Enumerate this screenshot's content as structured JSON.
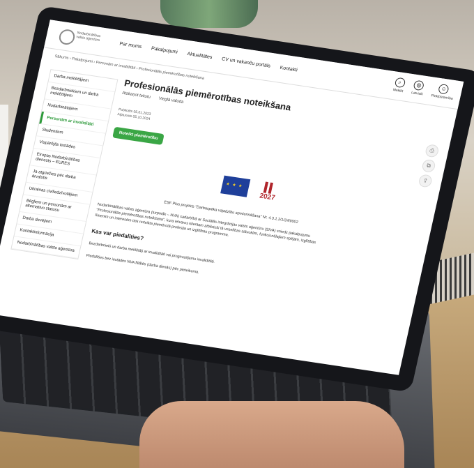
{
  "header": {
    "logo_text": "Nodarbinātības valsts aģentūra",
    "nav": [
      "Par mums",
      "Pakalpojumi",
      "Aktualitātes",
      "CV un vakanču portāls",
      "Kontakti"
    ],
    "tools": [
      "Meklēt",
      "Latviski",
      "Piekļūstamība"
    ]
  },
  "breadcrumb": "Sākums › Pakalpojumi › Personām ar invaliditāti › Profesionālās piemērotības noteikšana",
  "sidebar": {
    "items": [
      "Darba meklētājiem",
      "Bezdarbniekiem un darba meklētājiem",
      "Nodarbinātajiem",
      "Personām ar invaliditāti",
      "Studentiem",
      "Vispārējās iestādes",
      "Eiropas Nodarbinātības dienests – EURES",
      "Ja atgriežies pēc darba ārvalstīs",
      "Ukrainas civiliedzīvotājiem",
      "Bēgļiem un personām ar alternatīvo statusu",
      "Darba devējiem",
      "Kontaktinformācija",
      "Nodarbinātības valsts aģentūra"
    ],
    "active_index": 3
  },
  "main": {
    "title": "Profesionālās piemērotības noteikšana",
    "actions": [
      "Atskaņot tekstu",
      "Vieglā valoda"
    ],
    "published": "Publicēts 05.01.2023",
    "updated": "Atjaunots 05.10.2024",
    "button": "Noteikt piemērotību",
    "caption": "ESF Plus projekts \"Darbaspēka vajadzību apmierināšana\" Nr. 4.3.1.2/1/24/I/002",
    "paragraph": "Nodarbinātības valsts aģentūra (turpmāk – NVA) sadarbībā ar Sociālās integrācijas valsts aģentūru (SIVA) sniedz pakalpojumu \"Profesionālās piemērotības noteikšana\", kura ietvaros klientam atbilstoši tā veselības stāvoklim, funkcionālajiem spējām, izglītības līmenim un interesēm tiek noteikta piemērotā profesija un izglītības programma.",
    "heading": "Kas var piedalīties?",
    "para2": "Bezdarbnieki un darba meklētāji ar invaliditāti vai prognozējamu invaliditāti.",
    "para3": "Piedalīties bez iestādes NVA filiālēs (darba dienās) pēc pieteikuma."
  }
}
